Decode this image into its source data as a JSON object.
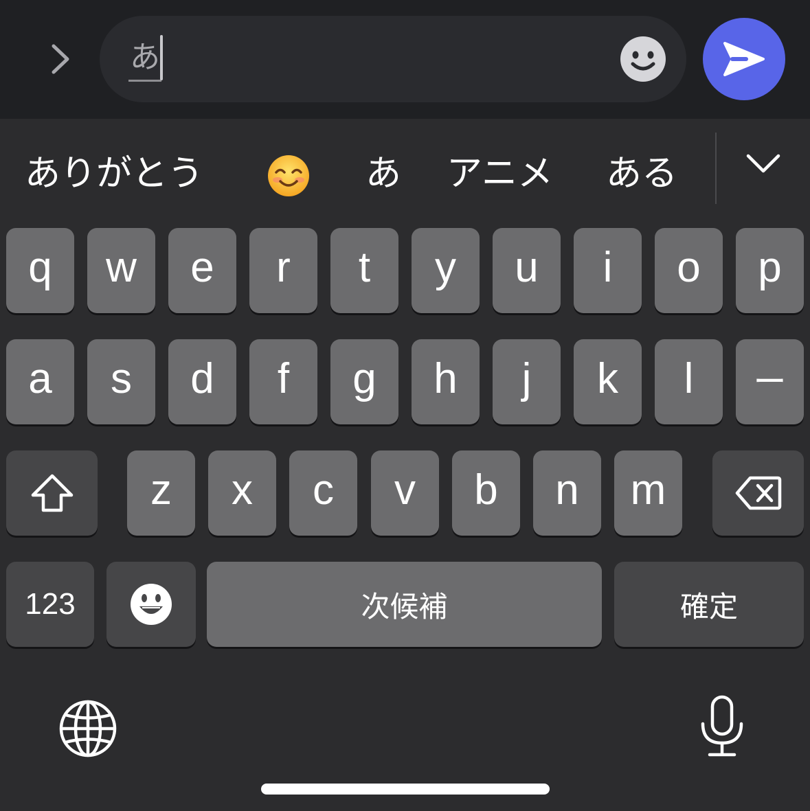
{
  "composer": {
    "input_value": "あ",
    "expand_icon": "chevron-right-icon",
    "emoji_icon": "smiley-icon",
    "send_icon": "send-icon",
    "send_color": "#5865e8"
  },
  "candidates": {
    "items": [
      "ありがとう",
      "😊",
      "あ",
      "アニメ",
      "ある"
    ],
    "expand_icon": "chevron-down-icon"
  },
  "keyboard": {
    "row1": [
      "q",
      "w",
      "e",
      "r",
      "t",
      "y",
      "u",
      "i",
      "o",
      "p"
    ],
    "row2": [
      "a",
      "s",
      "d",
      "f",
      "g",
      "h",
      "j",
      "k",
      "l",
      "ー"
    ],
    "row3": [
      "z",
      "x",
      "c",
      "v",
      "b",
      "n",
      "m"
    ],
    "shift_icon": "shift-icon",
    "delete_icon": "delete-icon",
    "numbers_label": "123",
    "emoji_key_icon": "emoji-icon",
    "space_label": "次候補",
    "confirm_label": "確定",
    "globe_icon": "globe-icon",
    "mic_icon": "microphone-icon"
  }
}
